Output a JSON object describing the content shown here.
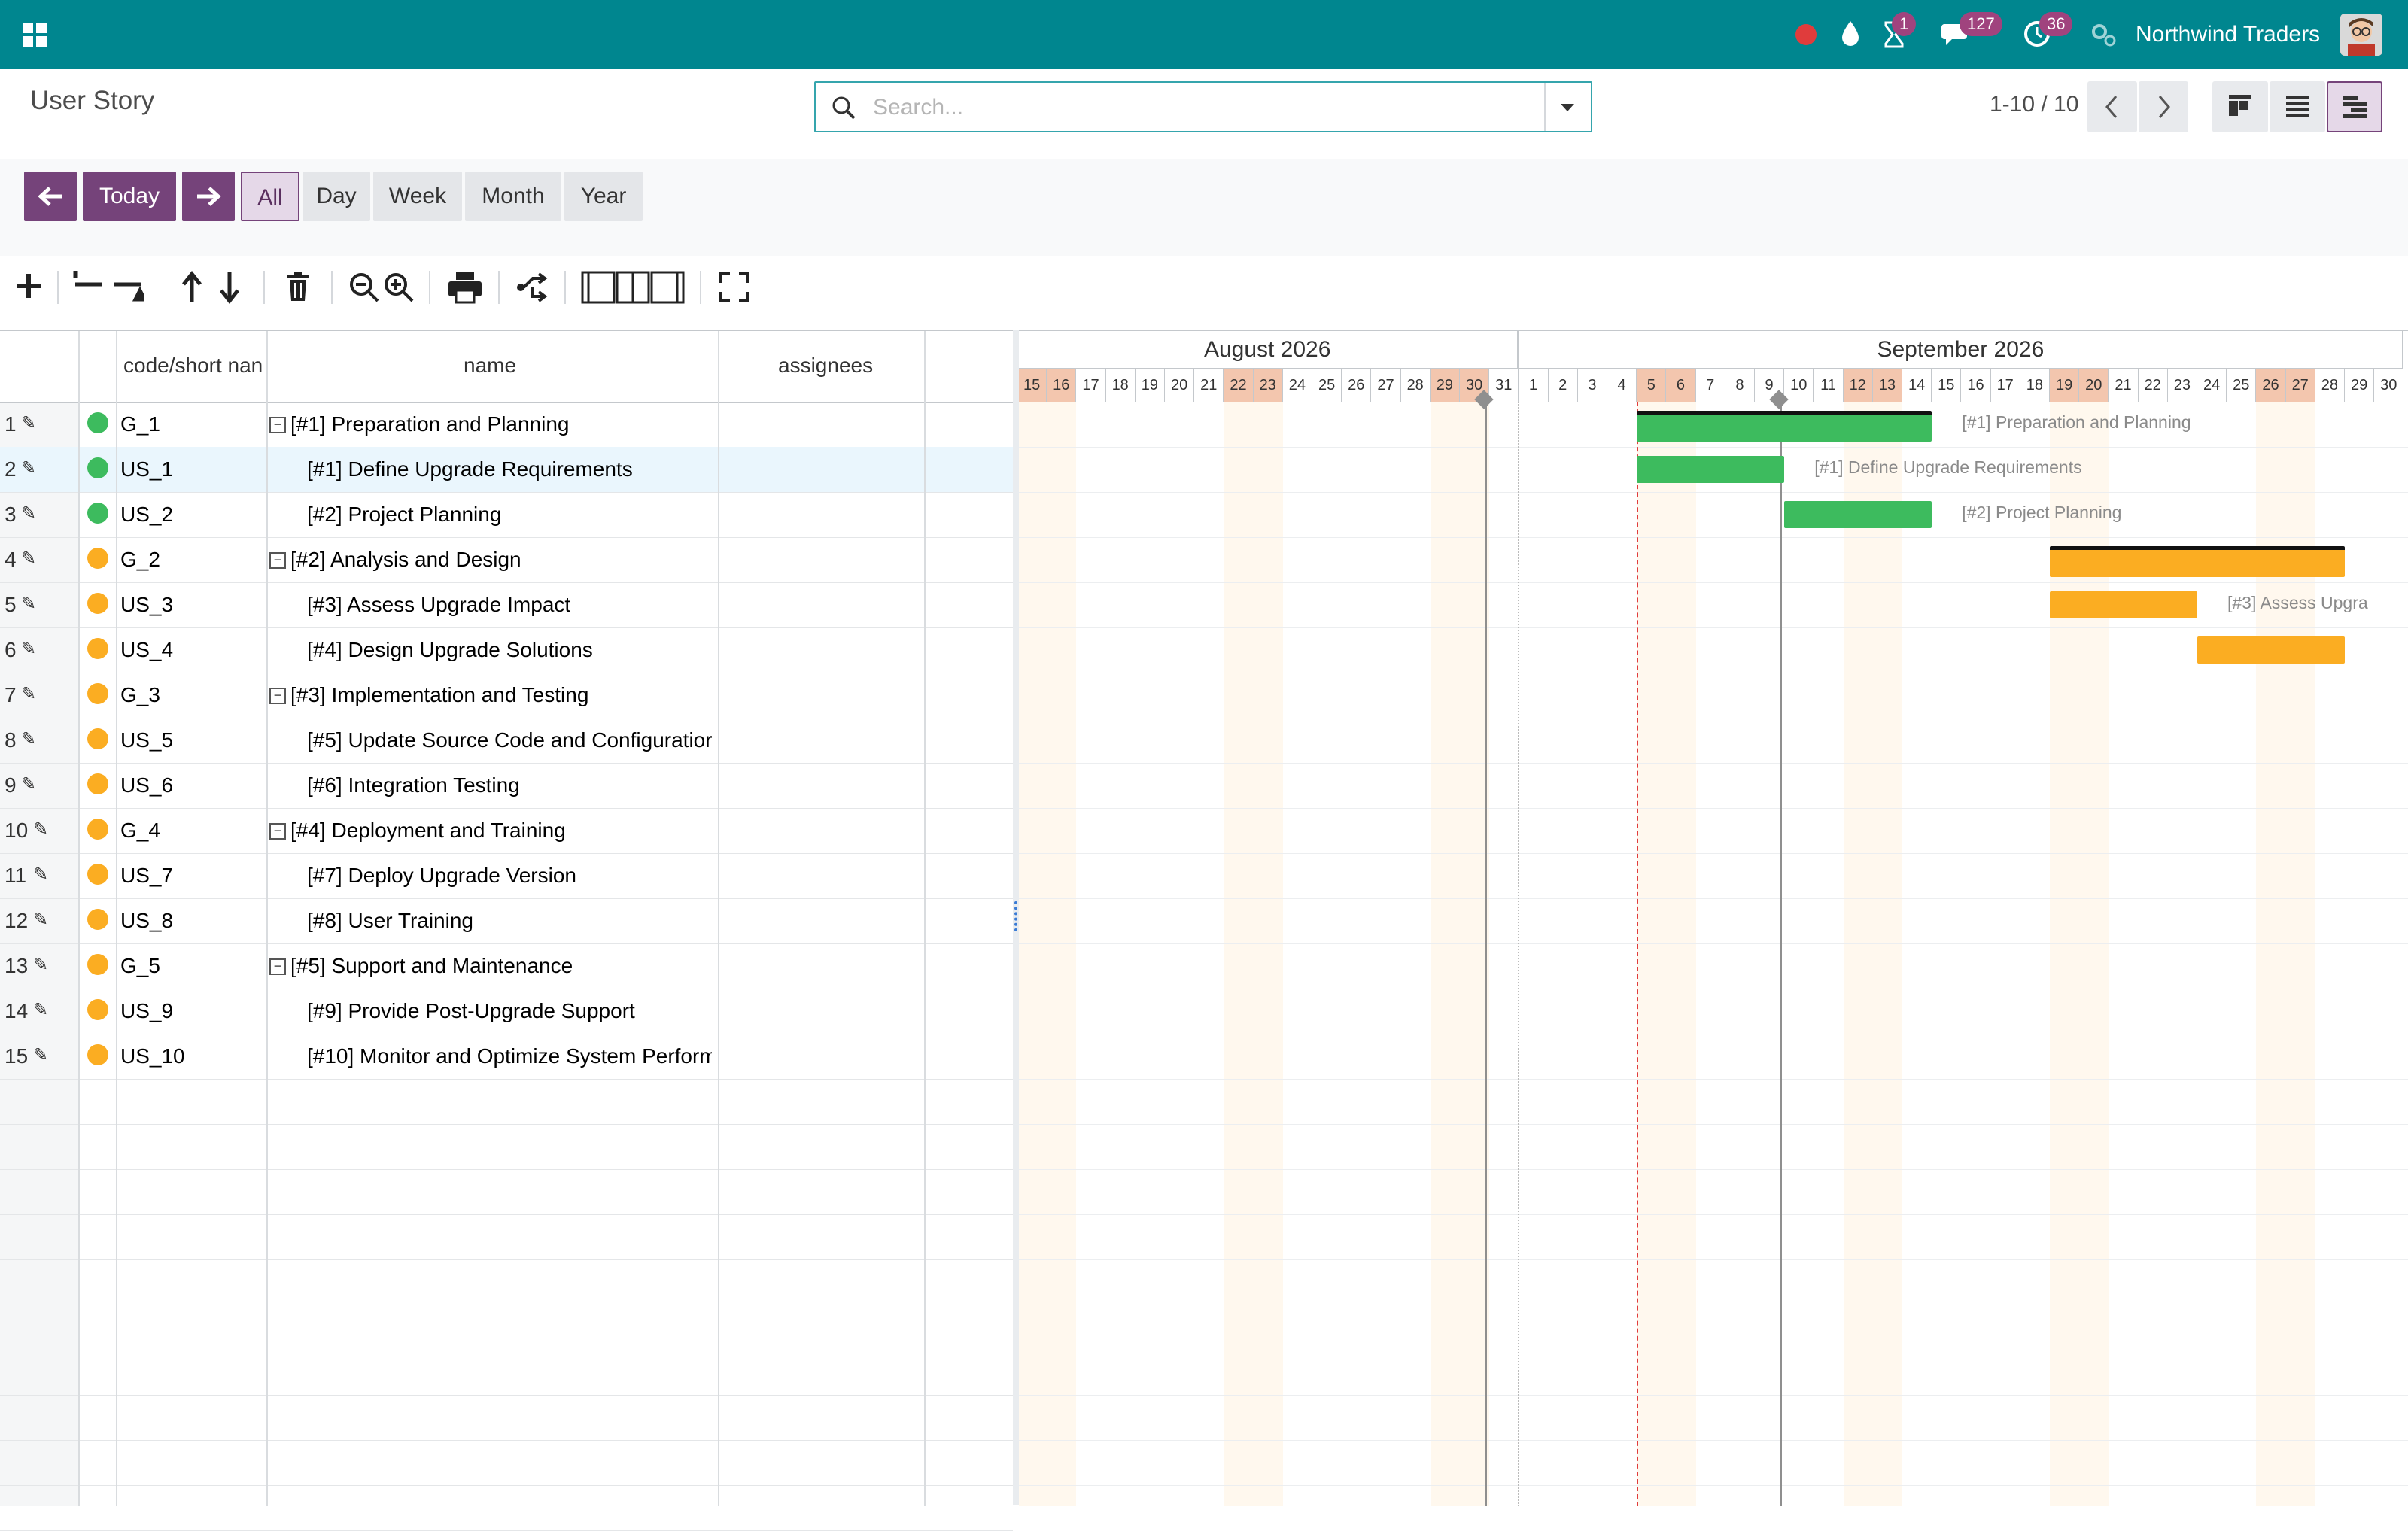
{
  "header": {
    "company": "Northwind Traders",
    "activity_badge": "1",
    "messages_badge": "127",
    "timer_badge": "36",
    "icons": [
      "apps-icon",
      "record-icon",
      "drop-icon",
      "hourglass-icon",
      "chat-icon",
      "clock-icon",
      "settings-icon"
    ]
  },
  "control": {
    "title": "User Story",
    "search_placeholder": "Search...",
    "pager": "1-10 / 10"
  },
  "scale": {
    "today": "Today",
    "tabs": [
      "All",
      "Day",
      "Week",
      "Month",
      "Year"
    ],
    "active": "All"
  },
  "grid": {
    "headers": {
      "code": "code/short nan",
      "name": "name",
      "assignees": "assignees"
    },
    "rows": [
      {
        "n": "1",
        "code": "G_1",
        "name": "[#1] Preparation and Planning",
        "group": true,
        "color": "#3dbb5e"
      },
      {
        "n": "2",
        "code": "US_1",
        "name": "[#1] Define Upgrade Requirements",
        "group": false,
        "color": "#3dbb5e"
      },
      {
        "n": "3",
        "code": "US_2",
        "name": "[#2] Project Planning",
        "group": false,
        "color": "#3dbb5e"
      },
      {
        "n": "4",
        "code": "G_2",
        "name": "[#2] Analysis and Design",
        "group": true,
        "color": "#fbad22"
      },
      {
        "n": "5",
        "code": "US_3",
        "name": "[#3] Assess Upgrade Impact",
        "group": false,
        "color": "#fbad22"
      },
      {
        "n": "6",
        "code": "US_4",
        "name": "[#4] Design Upgrade Solutions",
        "group": false,
        "color": "#fbad22"
      },
      {
        "n": "7",
        "code": "G_3",
        "name": "[#3] Implementation and Testing",
        "group": true,
        "color": "#fbad22"
      },
      {
        "n": "8",
        "code": "US_5",
        "name": "[#5] Update Source Code and Configuratior",
        "group": false,
        "color": "#fbad22"
      },
      {
        "n": "9",
        "code": "US_6",
        "name": "[#6] Integration Testing",
        "group": false,
        "color": "#fbad22"
      },
      {
        "n": "10",
        "code": "G_4",
        "name": "[#4] Deployment and Training",
        "group": true,
        "color": "#fbad22"
      },
      {
        "n": "11",
        "code": "US_7",
        "name": "[#7] Deploy Upgrade Version",
        "group": false,
        "color": "#fbad22"
      },
      {
        "n": "12",
        "code": "US_8",
        "name": "[#8] User Training",
        "group": false,
        "color": "#fbad22"
      },
      {
        "n": "13",
        "code": "G_5",
        "name": "[#5] Support and Maintenance",
        "group": true,
        "color": "#fbad22"
      },
      {
        "n": "14",
        "code": "US_9",
        "name": "[#9] Provide Post-Upgrade Support",
        "group": false,
        "color": "#fbad22"
      },
      {
        "n": "15",
        "code": "US_10",
        "name": "[#10] Monitor and Optimize System Perform",
        "group": false,
        "color": "#fbad22"
      }
    ]
  },
  "timeline": {
    "months": [
      {
        "label": "August 2026",
        "days": [
          15,
          16,
          17,
          18,
          19,
          20,
          21,
          22,
          23,
          24,
          25,
          26,
          27,
          28,
          29,
          30,
          31
        ],
        "weekends": [
          15,
          16,
          22,
          23,
          29,
          30
        ]
      },
      {
        "label": "September 2026",
        "days": [
          1,
          2,
          3,
          4,
          5,
          6,
          7,
          8,
          9,
          10,
          11,
          12,
          13,
          14,
          15,
          16,
          17,
          18,
          19,
          20,
          21,
          22,
          23,
          24,
          25,
          26,
          27,
          28,
          29,
          30
        ],
        "weekends": [
          5,
          6,
          12,
          13,
          19,
          20,
          26,
          27
        ]
      }
    ],
    "bars": [
      {
        "row": 0,
        "start": "2026-09-05",
        "end": "2026-09-14",
        "color": "#3dbb5e",
        "group": true,
        "label": "[#1] Preparation and Planning"
      },
      {
        "row": 1,
        "start": "2026-09-05",
        "end": "2026-09-09",
        "color": "#3dbb5e",
        "group": false,
        "label": "[#1] Define Upgrade Requirements"
      },
      {
        "row": 2,
        "start": "2026-09-10",
        "end": "2026-09-14",
        "color": "#3dbb5e",
        "group": false,
        "label": "[#2] Project Planning"
      },
      {
        "row": 3,
        "start": "2026-09-19",
        "end": "2026-09-28",
        "color": "#fbad22",
        "group": true,
        "label": ""
      },
      {
        "row": 4,
        "start": "2026-09-19",
        "end": "2026-09-23",
        "color": "#fbad22",
        "group": false,
        "label": "[#3] Assess Upgra"
      },
      {
        "row": 5,
        "start": "2026-09-24",
        "end": "2026-09-28",
        "color": "#fbad22",
        "group": false,
        "label": ""
      }
    ]
  }
}
